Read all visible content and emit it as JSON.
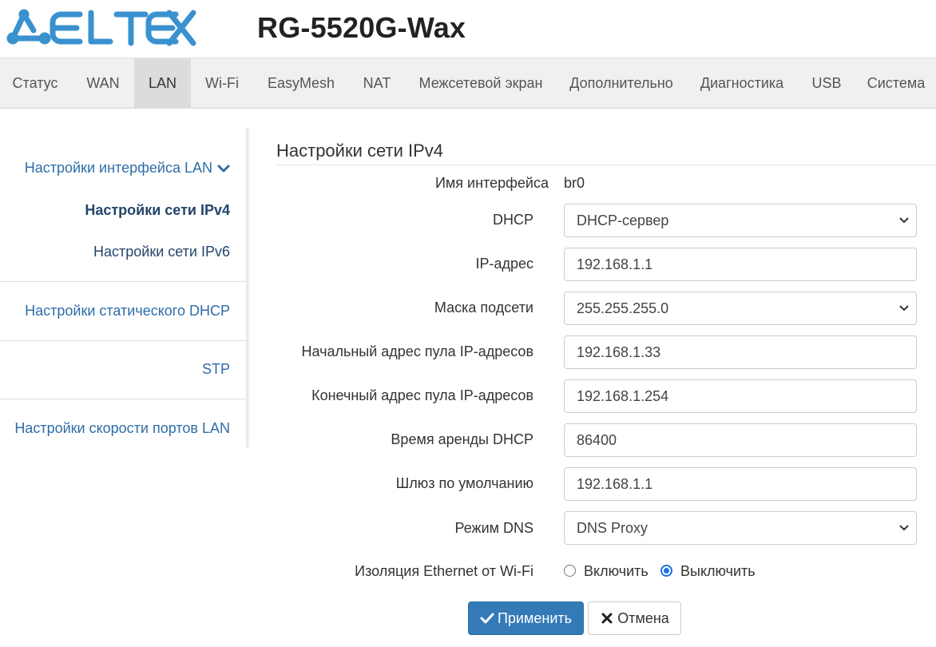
{
  "header": {
    "logo_text": "ELTEX",
    "model": "RG-5520G-Wax",
    "brand_color": "#3a91cf"
  },
  "topnav": {
    "active_index": 2,
    "tabs": [
      {
        "label": "Статус"
      },
      {
        "label": "WAN"
      },
      {
        "label": "LAN"
      },
      {
        "label": "Wi-Fi"
      },
      {
        "label": "EasyMesh"
      },
      {
        "label": "NAT"
      },
      {
        "label": "Межсетевой экран"
      },
      {
        "label": "Дополнительно"
      },
      {
        "label": "Диагностика"
      },
      {
        "label": "USB"
      },
      {
        "label": "Система"
      }
    ]
  },
  "sidebar": {
    "group_label": "Настройки интерфейса LAN",
    "group_icon": "chevron-down-icon",
    "sub_items": [
      {
        "label": "Настройки сети IPv4",
        "active": true
      },
      {
        "label": "Настройки сети IPv6",
        "active": false
      }
    ],
    "items": [
      {
        "label": "Настройки статического DHCP"
      },
      {
        "label": "STP"
      },
      {
        "label": "Настройки скорости портов LAN"
      }
    ]
  },
  "form": {
    "title": "Настройки сети IPv4",
    "interface_name": {
      "label": "Имя интерфейса",
      "value": "br0"
    },
    "dhcp": {
      "label": "DHCP",
      "value": "DHCP-сервер"
    },
    "ip_address": {
      "label": "IP-адрес",
      "value": "192.168.1.1"
    },
    "subnet_mask": {
      "label": "Маска подсети",
      "value": "255.255.255.0"
    },
    "pool_start": {
      "label": "Начальный адрес пула IP-адресов",
      "value": "192.168.1.33"
    },
    "pool_end": {
      "label": "Конечный адрес пула IP-адресов",
      "value": "192.168.1.254"
    },
    "lease_time": {
      "label": "Время аренды DHCP",
      "value": "86400"
    },
    "gateway": {
      "label": "Шлюз по умолчанию",
      "value": "192.168.1.1"
    },
    "dns_mode": {
      "label": "Режим DNS",
      "value": "DNS Proxy"
    },
    "isolation": {
      "label": "Изоляция Ethernet от Wi-Fi",
      "options": [
        {
          "label": "Включить",
          "checked": false
        },
        {
          "label": "Выключить",
          "checked": true
        }
      ]
    }
  },
  "buttons": {
    "apply_label": "Применить",
    "apply_icon": "check-icon",
    "cancel_label": "Отмена",
    "cancel_icon": "close-icon",
    "primary_color": "#337ab7"
  }
}
